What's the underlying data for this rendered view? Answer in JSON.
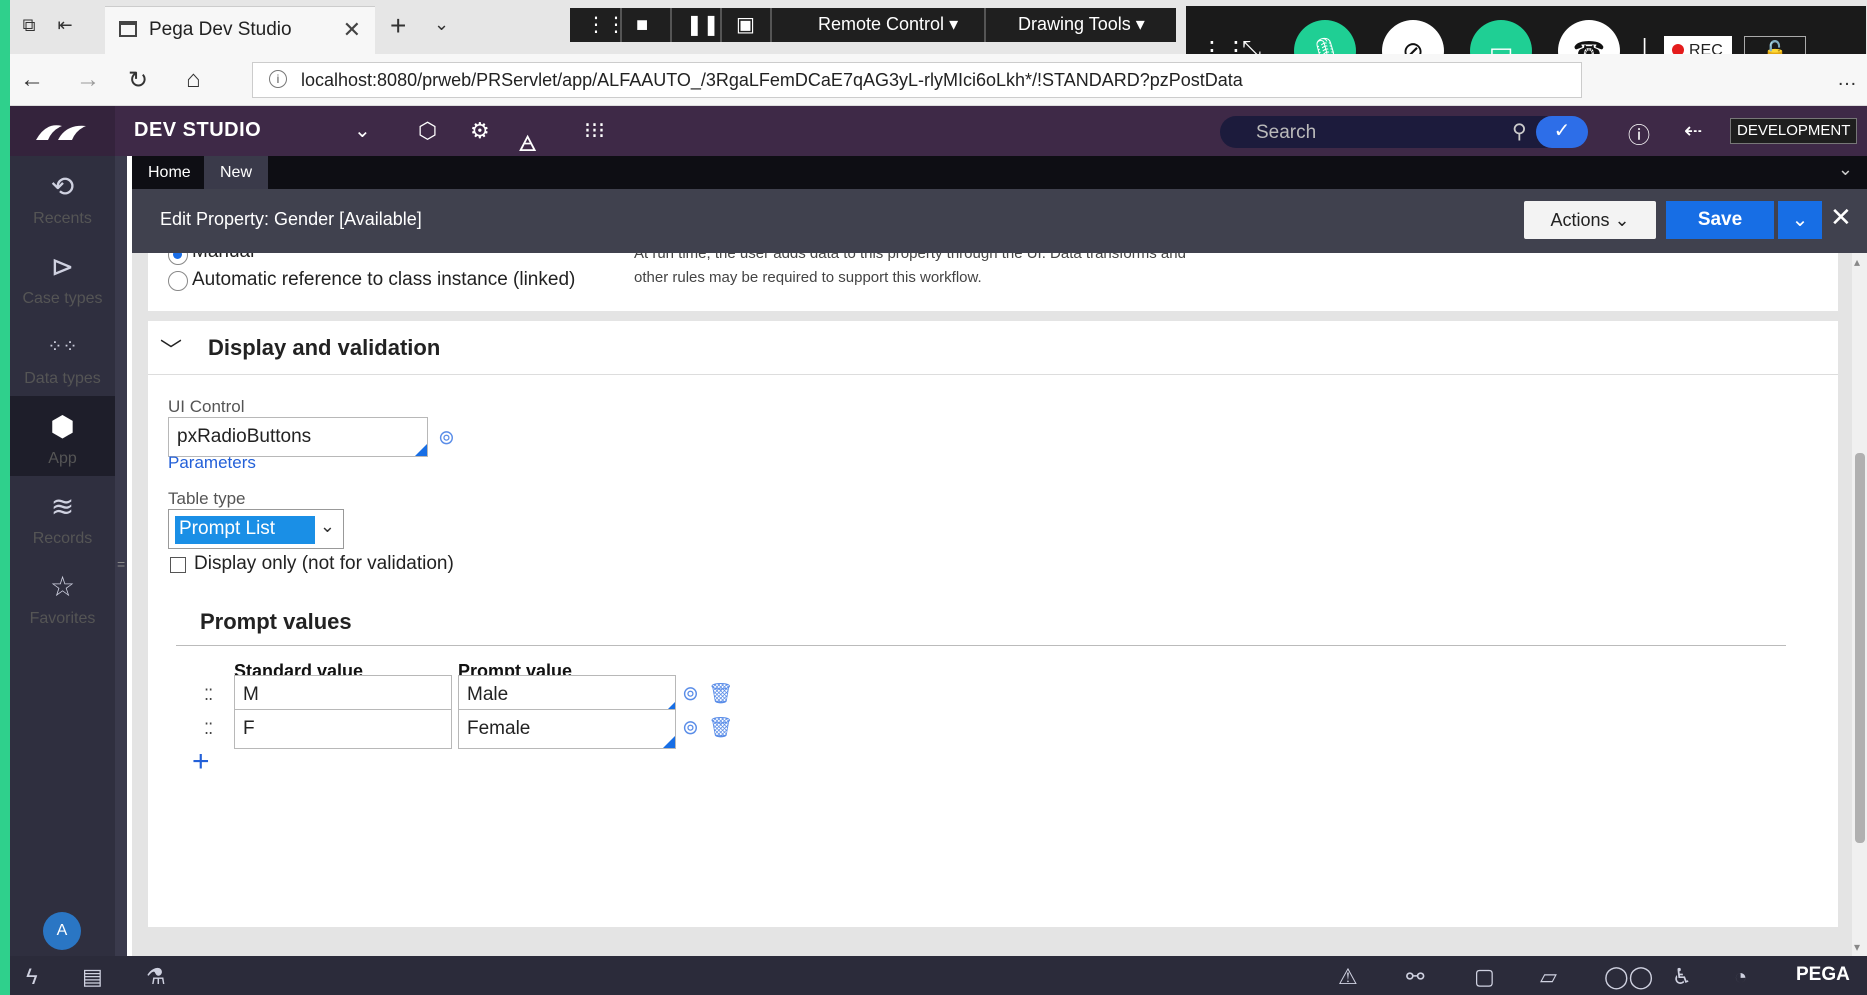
{
  "browser": {
    "tab_title": "Pega Dev Studio",
    "url": "localhost:8080/prweb/PRServlet/app/ALFAAUTO_/3RgaLFemDCaE7qAG3yL-rlyMIci6oLkh*/!STANDARD?pzPostData"
  },
  "remote_toolbar": {
    "remote_control": "Remote Control",
    "drawing_tools": "Drawing Tools"
  },
  "meeting": {
    "rec_label": "REC"
  },
  "header": {
    "studio": "DEV STUDIO",
    "search_placeholder": "Search",
    "env_badge": "DEVELOPMENT"
  },
  "leftnav": {
    "items": [
      {
        "label": "Recents",
        "icon": "history-icon"
      },
      {
        "label": "Case types",
        "icon": "case-types-icon"
      },
      {
        "label": "Data types",
        "icon": "data-types-icon"
      },
      {
        "label": "App",
        "icon": "app-cube-icon"
      },
      {
        "label": "Records",
        "icon": "records-icon"
      },
      {
        "label": "Favorites",
        "icon": "star-icon"
      }
    ],
    "avatar": "A"
  },
  "doc_tabs": [
    "Home",
    "New"
  ],
  "editbar": {
    "title": "Edit  Property: Gender [Available]",
    "actions": "Actions",
    "save": "Save"
  },
  "source": {
    "option_manual": "Manual",
    "option_linked": "Automatic reference to class instance (linked)",
    "desc_line1": "At run time, the user adds data to this property through the UI. Data transforms and",
    "desc_line2": "other rules may be required to support this workflow."
  },
  "display_validation": {
    "section_title": "Display and validation",
    "ui_control_label": "UI Control",
    "ui_control_value": "pxRadioButtons",
    "parameters_link": "Parameters",
    "table_type_label": "Table type",
    "table_type_value": "Prompt List",
    "display_only_label": "Display only (not for validation)",
    "prompt_values_title": "Prompt values",
    "col_standard": "Standard value",
    "col_prompt": "Prompt value",
    "rows": [
      {
        "standard": "M",
        "prompt": "Male"
      },
      {
        "standard": "F",
        "prompt": "Female"
      }
    ]
  },
  "bottom": {
    "brand": "PEGA"
  }
}
